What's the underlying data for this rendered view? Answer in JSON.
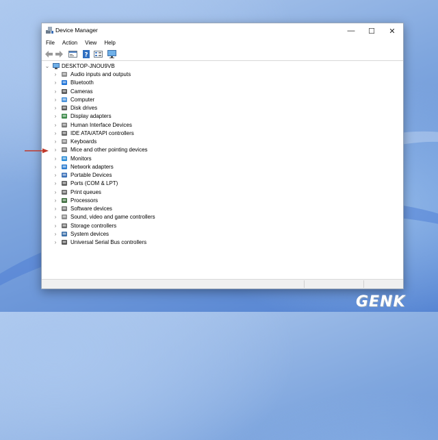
{
  "window": {
    "title": "Device Manager",
    "minimize_glyph": "—",
    "maximize_glyph": "☐",
    "close_glyph": "✕"
  },
  "menu": [
    "File",
    "Action",
    "View",
    "Help"
  ],
  "toolbar": [
    "back-icon",
    "forward-icon",
    "properties-icon",
    "help-icon",
    "view-icon",
    "monitor-icon"
  ],
  "tree": {
    "root": "DESKTOP-JNOU9VB",
    "categories": [
      {
        "label": "Audio inputs and outputs",
        "icon": "speaker-icon"
      },
      {
        "label": "Bluetooth",
        "icon": "bluetooth-icon"
      },
      {
        "label": "Cameras",
        "icon": "camera-icon"
      },
      {
        "label": "Computer",
        "icon": "computer-icon"
      },
      {
        "label": "Disk drives",
        "icon": "disk-icon"
      },
      {
        "label": "Display adapters",
        "icon": "display-adapter-icon"
      },
      {
        "label": "Human Interface Devices",
        "icon": "hid-icon"
      },
      {
        "label": "IDE ATA/ATAPI controllers",
        "icon": "ide-icon"
      },
      {
        "label": "Keyboards",
        "icon": "keyboard-icon"
      },
      {
        "label": "Mice and other pointing devices",
        "icon": "mouse-icon"
      },
      {
        "label": "Monitors",
        "icon": "monitor-icon"
      },
      {
        "label": "Network adapters",
        "icon": "network-icon"
      },
      {
        "label": "Portable Devices",
        "icon": "portable-device-icon"
      },
      {
        "label": "Ports (COM & LPT)",
        "icon": "port-icon"
      },
      {
        "label": "Print queues",
        "icon": "printer-icon"
      },
      {
        "label": "Processors",
        "icon": "processor-icon"
      },
      {
        "label": "Software devices",
        "icon": "software-device-icon"
      },
      {
        "label": "Sound, video and game controllers",
        "icon": "sound-icon"
      },
      {
        "label": "Storage controllers",
        "icon": "storage-icon"
      },
      {
        "label": "System devices",
        "icon": "system-icon"
      },
      {
        "label": "Universal Serial Bus controllers",
        "icon": "usb-icon"
      }
    ]
  },
  "watermark": "GENK",
  "colors": {
    "arrow": "#c0392b",
    "accent": "#2f7fd1"
  }
}
